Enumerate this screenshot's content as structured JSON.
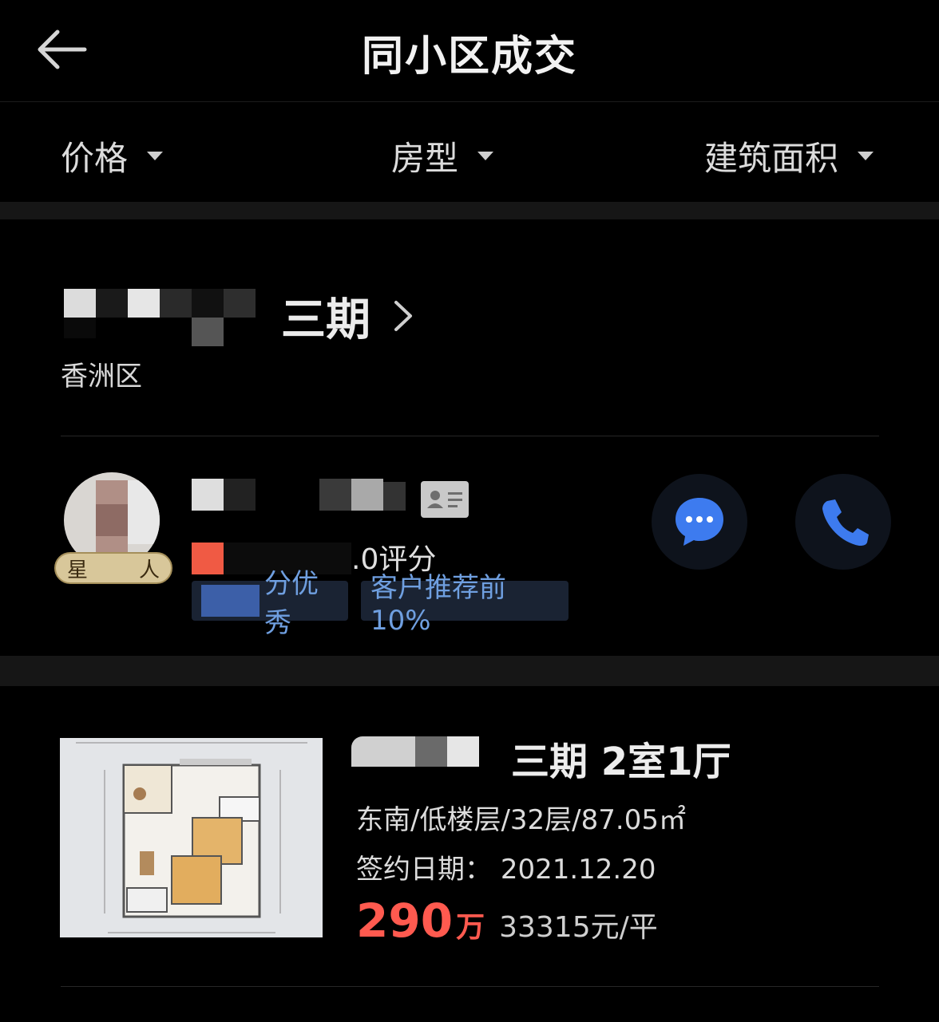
{
  "header": {
    "title": "同小区成交",
    "back_icon": "arrow-left-icon"
  },
  "filters": [
    {
      "label": "价格"
    },
    {
      "label": "房型"
    },
    {
      "label": "建筑面积"
    }
  ],
  "community": {
    "name_visible": "三期",
    "district": "香洲区"
  },
  "agent": {
    "badge_left": "星",
    "badge_right": "人",
    "rating_text": ".0评分",
    "tags": [
      "分优秀",
      "客户推荐前10%"
    ]
  },
  "listing": {
    "title_visible": "三期 2室1厅",
    "info": "东南/低楼层/32层/87.05㎡",
    "date_label": "签约日期：",
    "date_value": "2021.12.20",
    "price": "290",
    "price_unit": "万",
    "unit_price": "33315元/平"
  },
  "colors": {
    "price": "#ff5a4f",
    "tag_text": "#6f9fe0",
    "call_blue": "#3d7bef"
  }
}
